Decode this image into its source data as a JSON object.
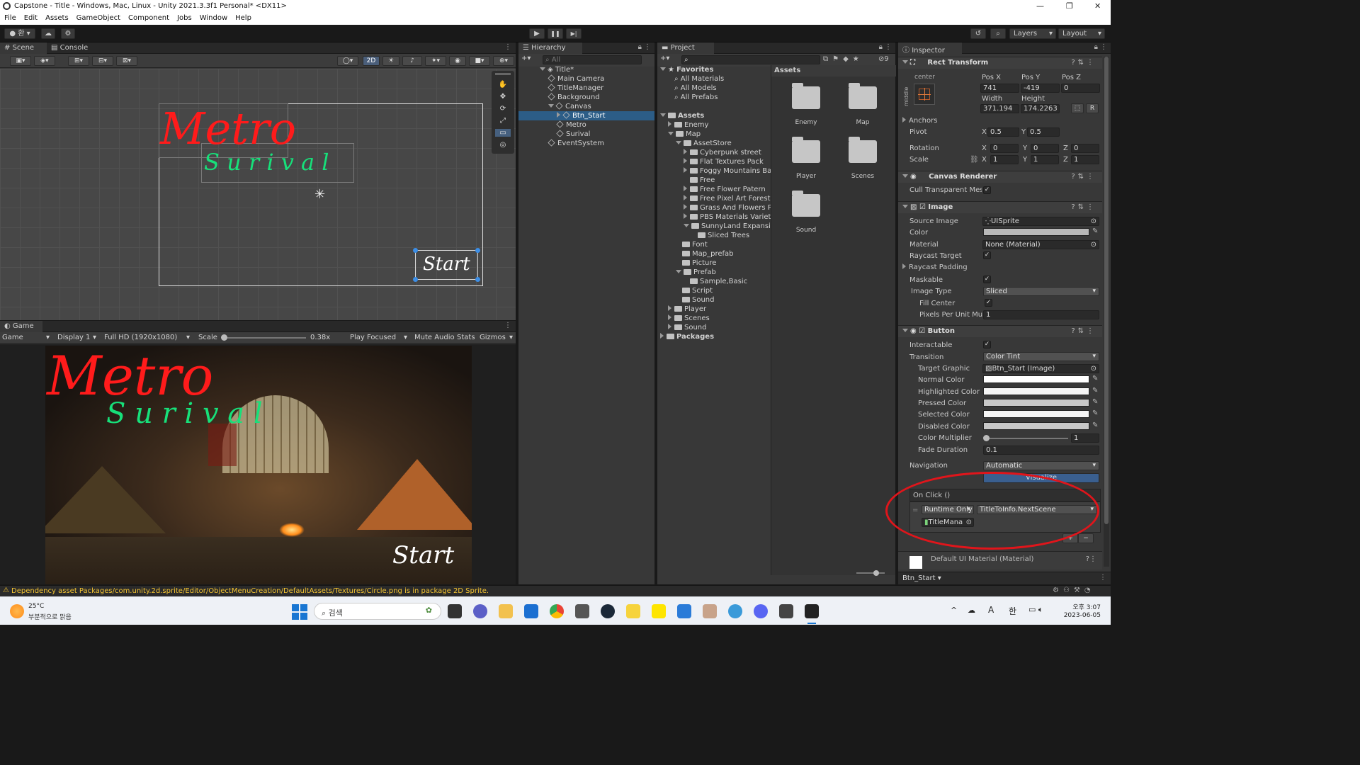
{
  "window": {
    "title": "Capstone - Title - Windows, Mac, Linux - Unity 2021.3.3f1 Personal* <DX11>"
  },
  "menu": [
    "File",
    "Edit",
    "Assets",
    "GameObject",
    "Component",
    "Jobs",
    "Window",
    "Help"
  ],
  "toolbar": {
    "account": "환",
    "layers": "Layers",
    "layout": "Layout",
    "play": "▶",
    "pause": "❚❚",
    "step": "▶|"
  },
  "scene": {
    "tabs": [
      "Scene",
      "Console"
    ],
    "mode_2d": "2D",
    "title_metro": "Metro",
    "title_surival": "S u r i v a l",
    "start_label": "Start"
  },
  "game": {
    "tab": "Game",
    "display_mode": "Game",
    "display": "Display 1",
    "resolution": "Full HD (1920x1080)",
    "scale_label": "Scale",
    "scale_value": "0.38x",
    "play_focused": "Play Focused",
    "mute": "Mute Audio",
    "stats": "Stats",
    "gizmos": "Gizmos",
    "title_metro": "Metro",
    "title_surival": "S u r i v a l",
    "start_label": "Start"
  },
  "hierarchy": {
    "tab": "Hierarchy",
    "search_placeholder": "All",
    "items": [
      {
        "label": "Title*",
        "depth": 0
      },
      {
        "label": "Main Camera",
        "depth": 1
      },
      {
        "label": "TitleManager",
        "depth": 1
      },
      {
        "label": "Background",
        "depth": 1
      },
      {
        "label": "Canvas",
        "depth": 1
      },
      {
        "label": "Btn_Start",
        "depth": 2
      },
      {
        "label": "Metro",
        "depth": 2
      },
      {
        "label": "Surival",
        "depth": 2
      },
      {
        "label": "EventSystem",
        "depth": 1
      }
    ]
  },
  "project": {
    "tab": "Project",
    "favorites_label": "Favorites",
    "favorites": [
      "All Materials",
      "All Models",
      "All Prefabs"
    ],
    "tree": [
      {
        "label": "Assets",
        "depth": 0
      },
      {
        "label": "Enemy",
        "depth": 1
      },
      {
        "label": "Map",
        "depth": 1
      },
      {
        "label": "AssetStore",
        "depth": 2
      },
      {
        "label": "Cyberpunk street",
        "depth": 3
      },
      {
        "label": "Flat Textures Pack",
        "depth": 3
      },
      {
        "label": "Foggy Mountains Bac",
        "depth": 3
      },
      {
        "label": "Free",
        "depth": 3
      },
      {
        "label": "Free Flower Patern",
        "depth": 3
      },
      {
        "label": "Free Pixel Art Forest",
        "depth": 3
      },
      {
        "label": "Grass And Flowers Pa",
        "depth": 3
      },
      {
        "label": "PBS Materials Variety",
        "depth": 3
      },
      {
        "label": "SunnyLand Expansion",
        "depth": 3
      },
      {
        "label": "Sliced Trees",
        "depth": 4
      },
      {
        "label": "Font",
        "depth": 2
      },
      {
        "label": "Map_prefab",
        "depth": 2
      },
      {
        "label": "Picture",
        "depth": 2
      },
      {
        "label": "Prefab",
        "depth": 2
      },
      {
        "label": "Sample,Basic",
        "depth": 3
      },
      {
        "label": "Script",
        "depth": 2
      },
      {
        "label": "Sound",
        "depth": 2
      },
      {
        "label": "Player",
        "depth": 1
      },
      {
        "label": "Scenes",
        "depth": 1
      },
      {
        "label": "Sound",
        "depth": 1
      },
      {
        "label": "Packages",
        "depth": 0
      }
    ],
    "assets_header": "Assets",
    "assets": [
      "Enemy",
      "Map",
      "Player",
      "Scenes",
      "Sound"
    ],
    "asset_count": "9"
  },
  "inspector": {
    "tab": "Inspector",
    "rect_transform": {
      "title": "Rect Transform",
      "anchor_preset": "center",
      "anchor_side": "middle",
      "pos_x_label": "Pos X",
      "pos_x": "741",
      "pos_y_label": "Pos Y",
      "pos_y": "-419",
      "pos_z_label": "Pos Z",
      "pos_z": "0",
      "width_label": "Width",
      "width": "371.194",
      "height_label": "Height",
      "height": "174.2263",
      "anchors_label": "Anchors",
      "pivot_label": "Pivot",
      "pivot_x": "0.5",
      "pivot_y": "0.5",
      "rotation_label": "Rotation",
      "rot_x": "0",
      "rot_y": "0",
      "rot_z": "0",
      "scale_label": "Scale",
      "scale_x": "1",
      "scale_y": "1",
      "scale_z": "1",
      "axis_x": "X",
      "axis_y": "Y",
      "axis_z": "Z",
      "raw_button": "R"
    },
    "canvas_renderer": {
      "title": "Canvas Renderer",
      "cull_label": "Cull Transparent Mesh"
    },
    "image": {
      "title": "Image",
      "source_label": "Source Image",
      "source": "UISprite",
      "color_label": "Color",
      "material_label": "Material",
      "material": "None (Material)",
      "raycast_target_label": "Raycast Target",
      "raycast_padding_label": "Raycast Padding",
      "maskable_label": "Maskable",
      "image_type_label": "Image Type",
      "image_type": "Sliced",
      "fill_center_label": "Fill Center",
      "ppu_label": "Pixels Per Unit Multi",
      "ppu": "1"
    },
    "button": {
      "title": "Button",
      "interactable_label": "Interactable",
      "transition_label": "Transition",
      "transition": "Color Tint",
      "target_label": "Target Graphic",
      "target": "Btn_Start (Image)",
      "normal_label": "Normal Color",
      "highlighted_label": "Highlighted Color",
      "pressed_label": "Pressed Color",
      "selected_label": "Selected Color",
      "disabled_label": "Disabled Color",
      "multiplier_label": "Color Multiplier",
      "multiplier": "1",
      "fade_label": "Fade Duration",
      "fade": "0.1",
      "navigation_label": "Navigation",
      "navigation": "Automatic",
      "visualize": "Visualize",
      "onclick_label": "On Click ()",
      "runtime": "Runtime Only",
      "function": "TitleToInfo.NextScene",
      "object": "TitleMana",
      "plus": "+",
      "minus": "−"
    },
    "material_footer": "Default UI Material (Material)",
    "footer_label": "Btn_Start"
  },
  "status": {
    "message": "Dependency asset Packages/com.unity.2d.sprite/Editor/ObjectMenuCreation/DefaultAssets/Textures/Circle.png is in package 2D Sprite."
  },
  "taskbar": {
    "weather_temp": "25°C",
    "weather_desc": "부분적으로 맑음",
    "search": "검색",
    "ime_a": "A",
    "ime_lang": "한",
    "time": "오후 3:07",
    "date": "2023-06-05"
  },
  "colors": {
    "selection": "#2c5d87",
    "metro_red": "#ff1b1b",
    "surival_green": "#17e07a",
    "highlight_ring": "#e0151b",
    "visualize_blue": "#3a5f8f"
  }
}
